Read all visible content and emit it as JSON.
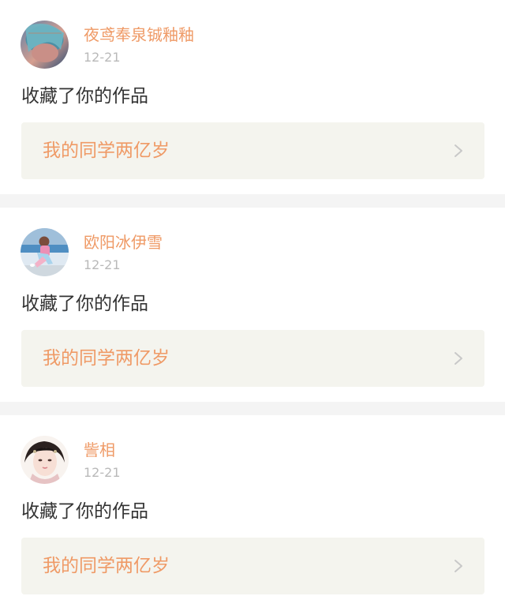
{
  "notifications": [
    {
      "user": "夜鸢奉泉铖釉釉",
      "time": "12-21",
      "action": "收藏了你的作品",
      "work_title": "我的同学两亿岁",
      "avatar_icon": "avatar-user-1",
      "chevron_icon": "chevron-right-icon"
    },
    {
      "user": "欧阳冰伊雪",
      "time": "12-21",
      "action": "收藏了你的作品",
      "work_title": "我的同学两亿岁",
      "avatar_icon": "avatar-user-2",
      "chevron_icon": "chevron-right-icon"
    },
    {
      "user": "訾相",
      "time": "12-21",
      "action": "收藏了你的作品",
      "work_title": "我的同学两亿岁",
      "avatar_icon": "avatar-user-3",
      "chevron_icon": "chevron-right-icon"
    }
  ],
  "colors": {
    "username": "#ef9a66",
    "work_title": "#ef9a66",
    "time": "#b9b9b9",
    "action": "#333333",
    "work_background": "#f4f4ee",
    "page_background": "#f4f4f4",
    "card_background": "#ffffff"
  }
}
